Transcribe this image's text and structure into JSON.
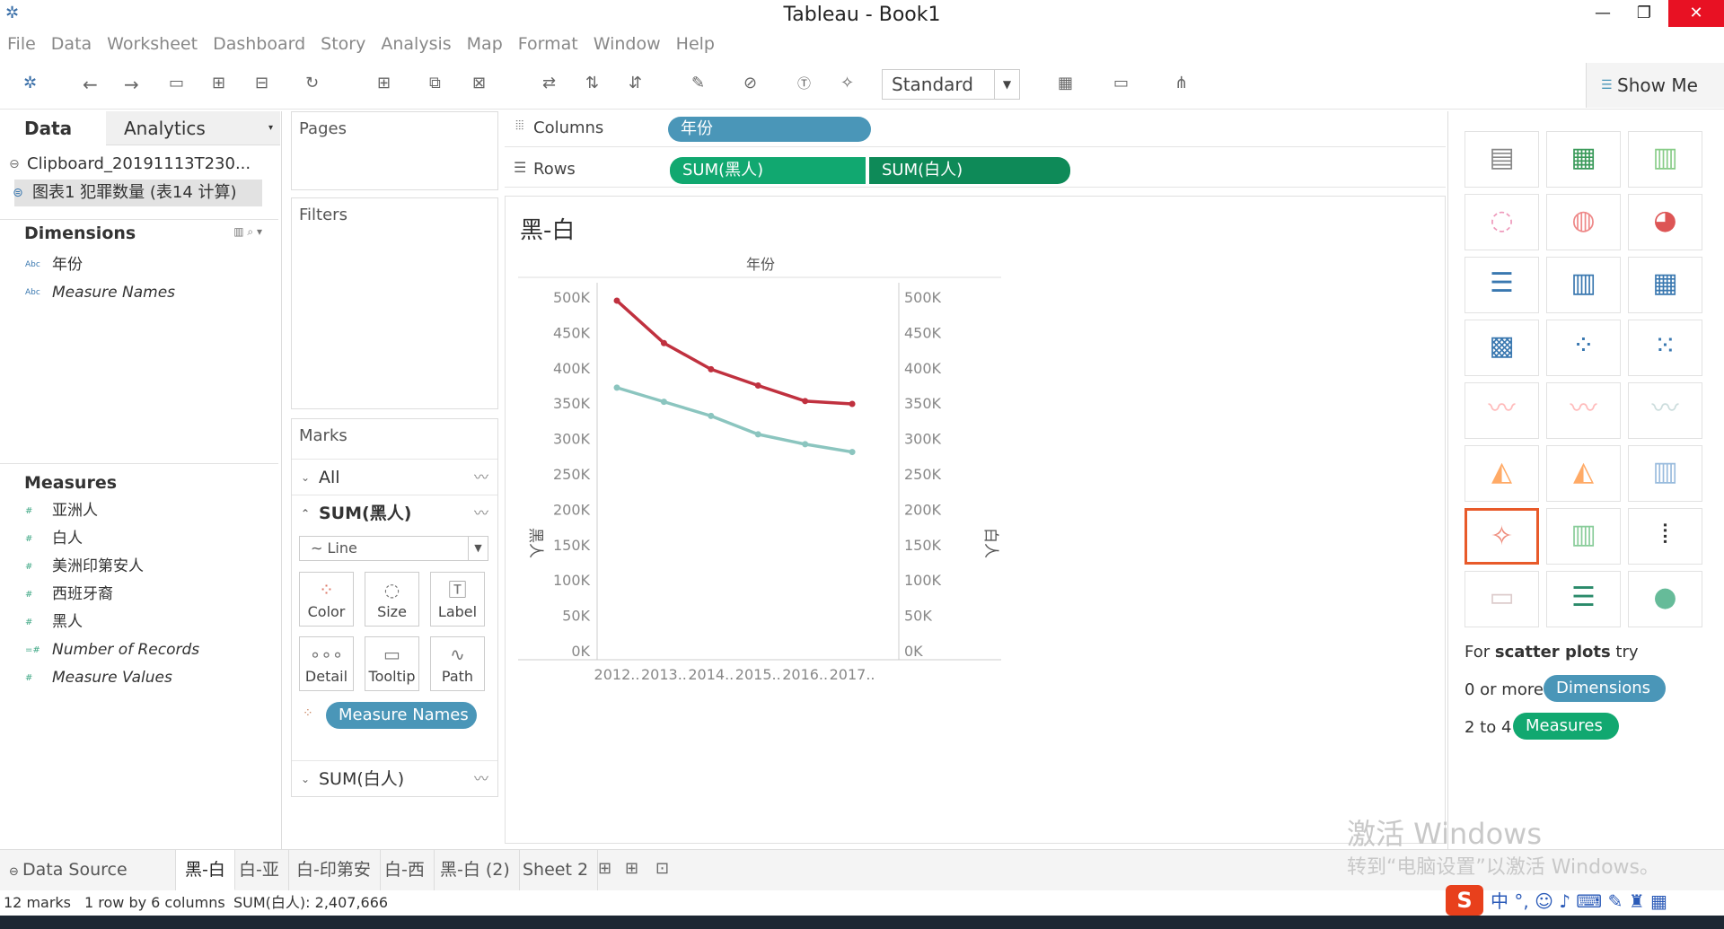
{
  "window": {
    "title": "Tableau - Book1",
    "min": "—",
    "max": "❐",
    "close": "✕"
  },
  "menu": [
    "File",
    "Data",
    "Worksheet",
    "Dashboard",
    "Story",
    "Analysis",
    "Map",
    "Format",
    "Window",
    "Help"
  ],
  "toolbar": {
    "fit": "Standard",
    "show_me": "Show Me"
  },
  "left": {
    "tab_data": "Data",
    "tab_analytics": "Analytics",
    "sources": [
      "Clipboard_20191113T230...",
      "图表1 犯罪数量 (表14 计算)"
    ],
    "dimensions_title": "Dimensions",
    "dimensions": [
      "年份",
      "Measure Names"
    ],
    "measures_title": "Measures",
    "measures": [
      "亚洲人",
      "白人",
      "美洲印第安人",
      "西班牙裔",
      "黑人",
      "Number of Records",
      "Measure Values"
    ]
  },
  "cards": {
    "pages": "Pages",
    "filters": "Filters",
    "marks": "Marks",
    "all": "All",
    "sum_black": "SUM(黑人)",
    "mark_type": "Line",
    "buttons": [
      "Color",
      "Size",
      "Label",
      "Detail",
      "Tooltip",
      "Path"
    ],
    "measure_names_pill": "Measure Names",
    "sum_white": "SUM(白人)"
  },
  "shelves": {
    "columns_label": "Columns",
    "rows_label": "Rows",
    "columns_pill": "年份",
    "rows_pills": [
      "SUM(黑人)",
      "SUM(白人)"
    ]
  },
  "chart_data": {
    "type": "line",
    "title": "黑-白",
    "xlabel": "年份",
    "ylabel": "黑人",
    "y2label": "白人",
    "categories": [
      "2012..",
      "2013..",
      "2014..",
      "2015..",
      "2016..",
      "2017.."
    ],
    "ylim": [
      0,
      500000
    ],
    "yticks": [
      "500K",
      "450K",
      "400K",
      "350K",
      "300K",
      "250K",
      "200K",
      "150K",
      "100K",
      "50K",
      "0K"
    ],
    "series": [
      {
        "name": "黑人",
        "color": "#c0313f",
        "values": [
          495000,
          435000,
          398000,
          375000,
          353000,
          349000
        ]
      },
      {
        "name": "白人",
        "color": "#8bc5bf",
        "values": [
          372000,
          352000,
          332000,
          306000,
          292000,
          281000
        ]
      }
    ]
  },
  "showme": {
    "hint_prefix": "For ",
    "hint_bold": "scatter plots",
    "hint_suffix": " try",
    "dims_prefix": "0 or more",
    "dims_pill": "Dimensions",
    "meas_prefix": "2 to 4",
    "meas_pill": "Measures"
  },
  "sheets": {
    "data_source": "Data Source",
    "tabs": [
      "黑-白",
      "白-亚",
      "白-印第安",
      "白-西",
      "黑-白 (2)",
      "Sheet 2"
    ]
  },
  "status": {
    "marks": "12 marks",
    "layout": "1 row by 6 columns",
    "sum": "SUM(白人): 2,407,666"
  },
  "watermark": {
    "line1": "激活 Windows",
    "line2": "转到“电脑设置”以激活 Windows。"
  },
  "colors": {
    "accent": "#4a96b8",
    "green": "#11a870",
    "dark_green": "#0e8a58"
  }
}
